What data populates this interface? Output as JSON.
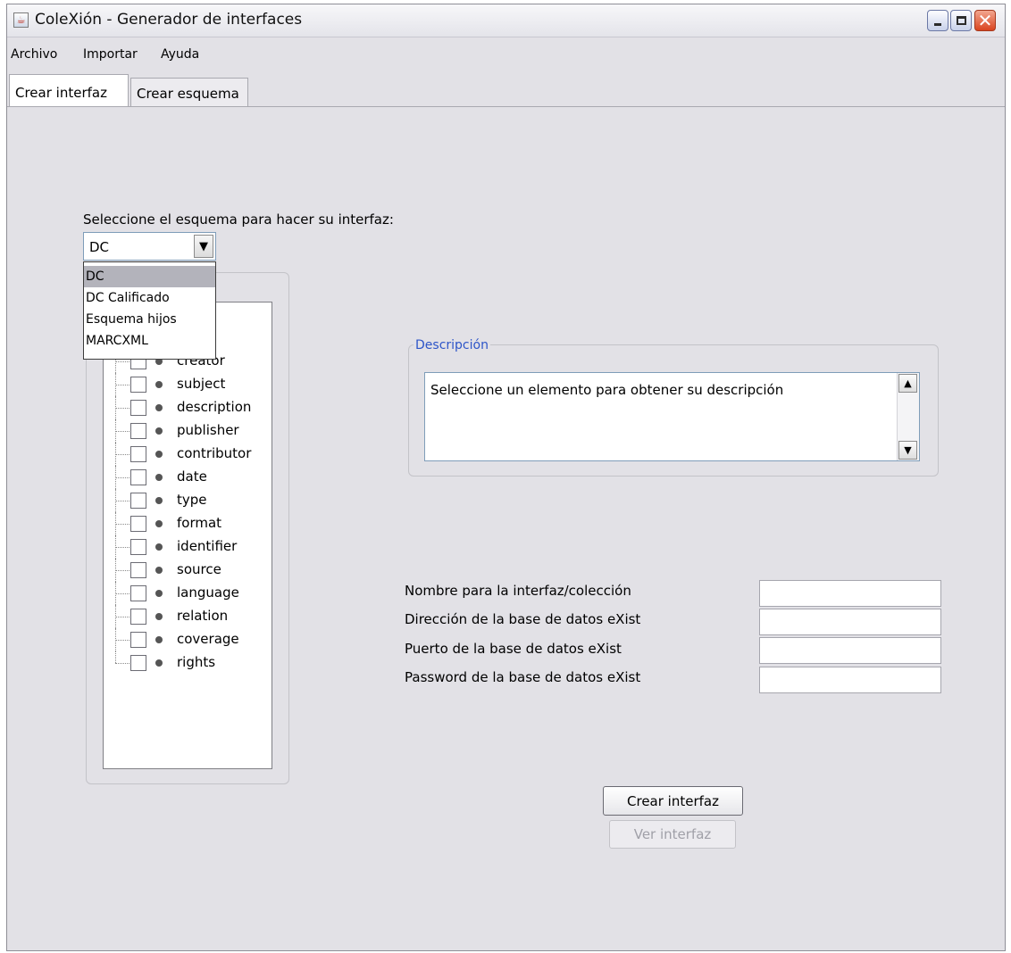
{
  "window": {
    "title": "ColeXión - Generador de interfaces"
  },
  "menu": {
    "items": [
      "Archivo",
      "Importar",
      "Ayuda"
    ]
  },
  "tabs": [
    {
      "label": "Crear interfaz",
      "active": true
    },
    {
      "label": "Crear esquema",
      "active": false
    }
  ],
  "schema": {
    "prompt": "Seleccione el esquema para hacer su interfaz:",
    "selected": "DC",
    "options": [
      "DC",
      "DC Calificado",
      "Esquema hijos",
      "MARCXML"
    ]
  },
  "tree": {
    "items": [
      "creator",
      "subject",
      "description",
      "publisher",
      "contributor",
      "date",
      "type",
      "format",
      "identifier",
      "source",
      "language",
      "relation",
      "coverage",
      "rights"
    ]
  },
  "description": {
    "title": "Descripción",
    "text": "Seleccione un elemento para obtener su descripción"
  },
  "form": {
    "fields": [
      {
        "label": "Nombre para la interfaz/colección",
        "value": ""
      },
      {
        "label": "Dirección de la base de datos eXist",
        "value": ""
      },
      {
        "label": "Puerto de la base de datos eXist",
        "value": ""
      },
      {
        "label": "Password de la base de datos eXist",
        "value": ""
      }
    ]
  },
  "actions": {
    "create_label": "Crear interfaz",
    "view_label": "Ver interfaz"
  },
  "colors": {
    "window_bg": "#e2e1e6",
    "accent_title": "#2d55c8",
    "close_button": "#d9441f"
  }
}
